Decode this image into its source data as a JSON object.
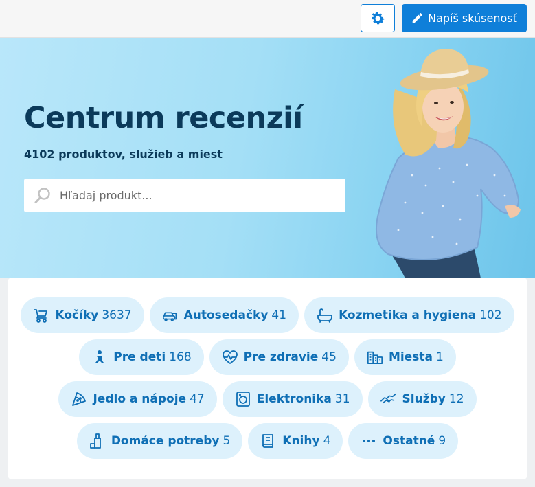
{
  "header": {
    "settings_icon": "gear-icon",
    "write_button_label": "Napíš skúsenosť",
    "write_icon": "pencil-icon"
  },
  "hero": {
    "title": "Centrum recenzií",
    "subtitle": "4102 produktov, služieb a miest",
    "search_placeholder": "Hľadaj produkt...",
    "search_icon": "search-icon",
    "image": "smiling-woman-straw-hat-photo"
  },
  "categories": [
    {
      "id": "kociky",
      "name": "Kočíky",
      "count": "3637",
      "icon": "stroller-icon"
    },
    {
      "id": "autosedacky",
      "name": "Autosedačky",
      "count": "41",
      "icon": "car-icon"
    },
    {
      "id": "kozmetika",
      "name": "Kozmetika a hygiena",
      "count": "102",
      "icon": "bathtub-icon"
    },
    {
      "id": "pre-deti",
      "name": "Pre deti",
      "count": "168",
      "icon": "baby-icon"
    },
    {
      "id": "pre-zdravie",
      "name": "Pre zdravie",
      "count": "45",
      "icon": "heartbeat-icon"
    },
    {
      "id": "miesta",
      "name": "Miesta",
      "count": "1",
      "icon": "city-icon"
    },
    {
      "id": "jedlo",
      "name": "Jedlo a nápoje",
      "count": "47",
      "icon": "pizza-icon"
    },
    {
      "id": "elektronika",
      "name": "Elektronika",
      "count": "31",
      "icon": "washing-machine-icon"
    },
    {
      "id": "sluzby",
      "name": "Služby",
      "count": "12",
      "icon": "handshake-icon"
    },
    {
      "id": "domace",
      "name": "Domáce potreby",
      "count": "5",
      "icon": "cleaning-icon"
    },
    {
      "id": "knihy",
      "name": "Knihy",
      "count": "4",
      "icon": "book-icon"
    },
    {
      "id": "ostatne",
      "name": "Ostatné",
      "count": "9",
      "icon": "more-icon"
    }
  ],
  "colors": {
    "accent": "#0f7fd9",
    "chip_bg": "#ddf1fc",
    "chip_text": "#0f6fb5",
    "title_text": "#0b3a5a"
  }
}
